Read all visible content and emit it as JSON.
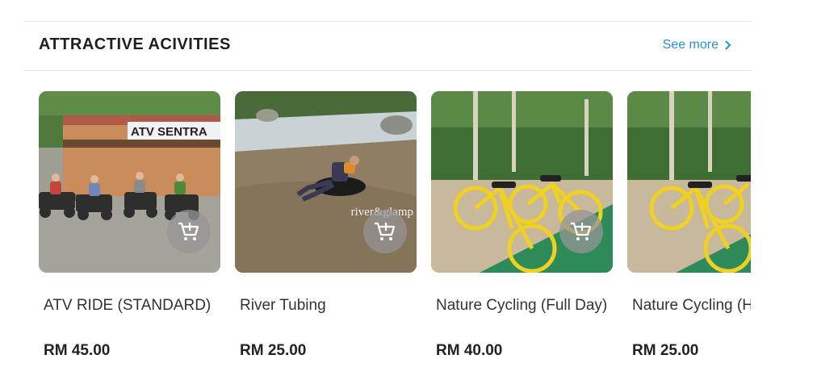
{
  "section": {
    "title": "ATTRACTIVE ACIVITIES",
    "see_more": "See more"
  },
  "cards": [
    {
      "name": "ATV RIDE (STANDARD)",
      "price": "RM 45.00",
      "image_sign": "ATV SENTRA"
    },
    {
      "name": "River Tubing",
      "price": "RM 25.00",
      "watermark": "river&glamp"
    },
    {
      "name": "Nature Cycling (Full Day)",
      "price": "RM 40.00"
    },
    {
      "name": "Nature Cycling (Half Day)",
      "price": "RM 25.00"
    }
  ],
  "icons": {
    "cart": "add-to-cart-icon",
    "see_more": "chevron-right-icon"
  },
  "colors": {
    "accent": "#2a8fd6",
    "cart_button": "#969696"
  }
}
